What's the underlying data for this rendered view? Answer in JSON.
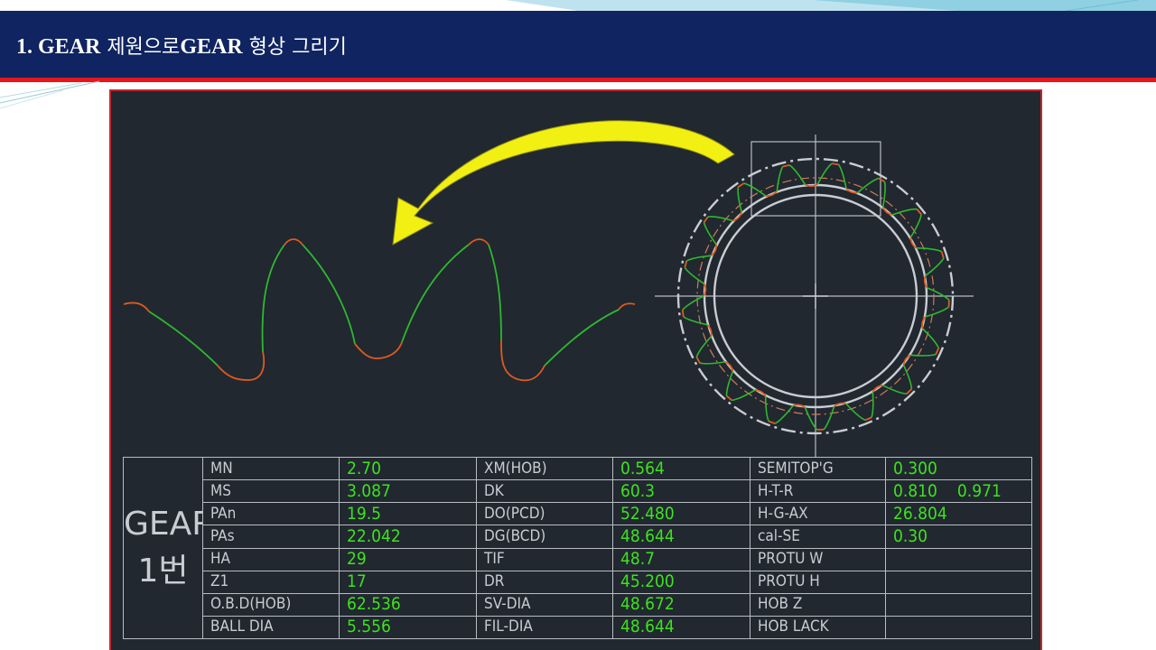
{
  "slide": {
    "title": "1. GEAR",
    "title_ko_1": " 제원으로",
    "title_part2": "GEAR",
    "title_ko_2": " 형상 그리기"
  },
  "colors": {
    "header_bg": "#0f2460",
    "header_rule": "#e8151b",
    "cad_bg": "#212830",
    "tooth_flank": "#2fb82f",
    "tooth_root": "#e05a1e",
    "arrow": "#f2ef12",
    "value_text": "#3ee21d"
  },
  "gear_label": {
    "line1": "GEAR",
    "line2": "1번"
  },
  "spec_rows": [
    {
      "k1": "MN",
      "v1": "2.70",
      "k2": "XM(HOB)",
      "v2": "0.564",
      "k3": "SEMITOP'G",
      "v3": "0.300",
      "v3b": ""
    },
    {
      "k1": "MS",
      "v1": "3.087",
      "k2": "DK",
      "v2": "60.3",
      "k3": "H-T-R",
      "v3": "0.810",
      "v3b": "0.971"
    },
    {
      "k1": "PAn",
      "v1": "19.5",
      "k2": "DO(PCD)",
      "v2": "52.480",
      "k3": "H-G-AX",
      "v3": "26.804",
      "v3b": ""
    },
    {
      "k1": "PAs",
      "v1": "22.042",
      "k2": "DG(BCD)",
      "v2": "48.644",
      "k3": "cal-SE",
      "v3": "0.30",
      "v3b": ""
    },
    {
      "k1": "HA",
      "v1": "29",
      "k2": "TIF",
      "v2": "48.7",
      "k3": "PROTU W",
      "v3": "",
      "v3b": ""
    },
    {
      "k1": "Z1",
      "v1": "17",
      "k2": "DR",
      "v2": "45.200",
      "k3": "PROTU H",
      "v3": "",
      "v3b": ""
    },
    {
      "k1": "O.B.D(HOB)",
      "v1": "62.536",
      "k2": "SV-DIA",
      "v2": "48.672",
      "k3": "HOB Z",
      "v3": "",
      "v3b": ""
    },
    {
      "k1": "BALL DIA",
      "v1": "5.556",
      "k2": "FIL-DIA",
      "v2": "48.644",
      "k3": "HOB LACK",
      "v3": "",
      "v3b": ""
    }
  ],
  "drawing": {
    "gear_tooth_count": 17,
    "profile_teeth_shown": 2
  }
}
